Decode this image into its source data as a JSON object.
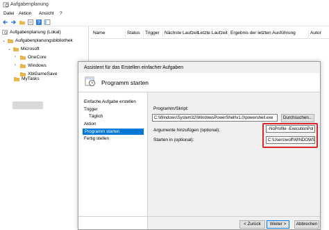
{
  "window": {
    "title": "Aufgabenplanung"
  },
  "menu": {
    "items": [
      "Datei",
      "Aktion",
      "Ansicht",
      "?"
    ]
  },
  "tree": {
    "items": [
      {
        "label": "Aufgabenplanung (Lokal)",
        "icon": "task-scheduler-icon"
      },
      {
        "label": "Aufgabenplanungsbibliothek",
        "icon": "folder-icon"
      },
      {
        "label": "Microsoft",
        "icon": "folder-icon"
      },
      {
        "label": "OneCore",
        "icon": "folder-icon"
      },
      {
        "label": "Windows",
        "icon": "folder-icon"
      },
      {
        "label": "XblGameSave",
        "icon": "folder-icon"
      },
      {
        "label": "MyTasks",
        "icon": "folder-icon"
      }
    ]
  },
  "list": {
    "columns": [
      "Name",
      "Status",
      "Trigger",
      "Nächste Laufzeit",
      "Letzte Laufzeit",
      "Ergebnis der letzten Ausführung",
      "Autor"
    ]
  },
  "dialog": {
    "title": "Assistent für das Erstellen einfacher Aufgaben",
    "header": "Programm starten",
    "steps": [
      "Einfache Aufgabe erstellen",
      "Trigger",
      "Täglich",
      "Aktion",
      "Programm starten",
      "Fertig stellen"
    ],
    "active_step": "Programm starten",
    "program_label": "Programm/Skript:",
    "program_value": "C:\\Windows\\System32\\WindowsPowerShell\\v1.0\\powershell.exe",
    "browse_label": "Durchsuchen...",
    "args_label": "Argumente hinzufügen (optional):",
    "args_value": "-NoProfile -ExecutionPol",
    "start_label": "Starten in (optional):",
    "start_value": "C:\\Users\\wolf\\WINDOWS\\",
    "back_label": "< Zurück",
    "next_label": "Weiter >",
    "cancel_label": "Abbrechen"
  },
  "colors": {
    "accent": "#0078d7",
    "highlight": "#d9262b",
    "folder": "#e8b64c"
  }
}
